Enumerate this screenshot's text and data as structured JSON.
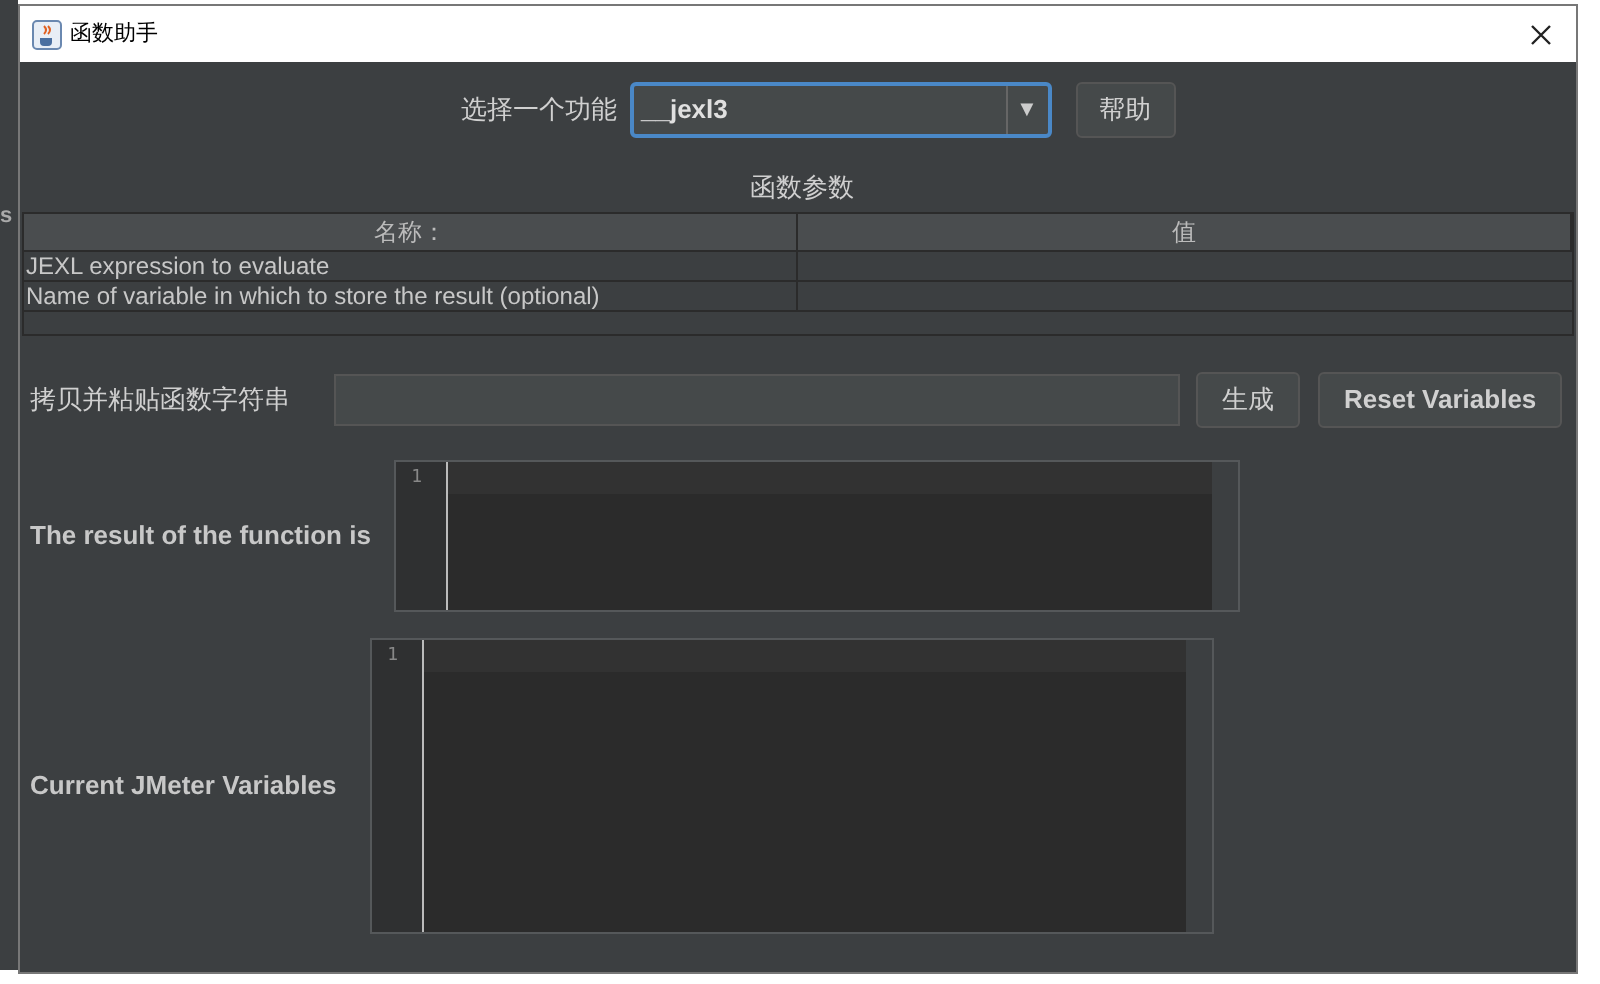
{
  "background_text": "s",
  "window": {
    "title": "函数助手"
  },
  "function_select": {
    "label": "选择一个功能",
    "value": "__jexl3",
    "arrow": "▼"
  },
  "help_button": "帮助",
  "params": {
    "title": "函数参数",
    "columns": [
      "名称：",
      "值"
    ],
    "rows": [
      {
        "name": "JEXL expression to evaluate"
      },
      {
        "name": "Name of variable in which to store the result (optional)"
      }
    ]
  },
  "copy": {
    "label": "拷贝并粘贴函数字符串",
    "generate_button": "生成",
    "reset_button": "Reset Variables"
  },
  "result": {
    "label": "The result of the function is",
    "line_number": "1"
  },
  "variables": {
    "label": "Current JMeter Variables",
    "line_number": "1"
  }
}
